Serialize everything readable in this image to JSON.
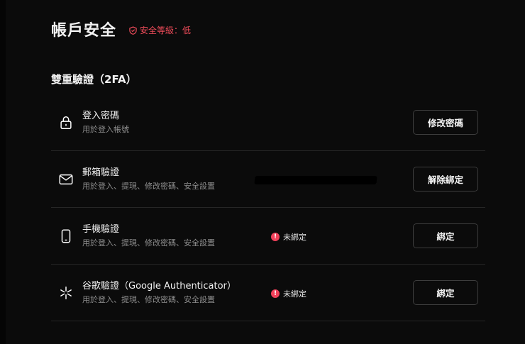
{
  "header": {
    "title": "帳戶安全",
    "security_level": "安全等級：低"
  },
  "section": {
    "title": "雙重驗證（2FA）"
  },
  "colors": {
    "danger": "#ef4c5a",
    "background": "#0b0b0b",
    "divider": "#262626"
  },
  "rows": [
    {
      "icon": "lock-icon",
      "title": "登入密碼",
      "desc": "用於登入帳號",
      "status": "",
      "action": "修改密碼"
    },
    {
      "icon": "mail-icon",
      "title": "郵箱驗證",
      "desc": "用於登入、提現、修改密碼、安全設置",
      "status": "",
      "action": "解除綁定"
    },
    {
      "icon": "phone-icon",
      "title": "手機驗證",
      "desc": "用於登入、提現、修改密碼、安全設置",
      "status": "未綁定",
      "action": "綁定"
    },
    {
      "icon": "authenticator-icon",
      "title": "谷歌驗證（Google Authenticator）",
      "desc": "用於登入、提現、修改密碼、安全設置",
      "status": "未綁定",
      "action": "綁定"
    }
  ]
}
